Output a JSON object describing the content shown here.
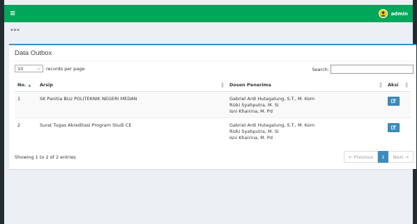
{
  "navbar": {
    "menu_icon": "hamburger-icon",
    "user_name": "admin",
    "user_icon": "avatar-icon",
    "color": "#00a65a"
  },
  "breadcrumb": "***",
  "box": {
    "title": "Data Outbox",
    "length_value": "10",
    "length_label": "records per page",
    "search_label": "Search:",
    "search_value": "",
    "accent": "#3c8dbc"
  },
  "table": {
    "headers": {
      "no": "No.",
      "arsip": "Arsip",
      "dosen": "Dosen Penerima",
      "aksi": "Aksi"
    },
    "rows": [
      {
        "no": "1",
        "arsip": "SK Panitia BLU POLITEKNIK NEGERI MEDAN",
        "dosen": [
          "Gabriel Ardi Hutagalung, S.T., M. Kom",
          "Rizki Syahputra, M. Si",
          "Isni Khairina, M. Pd"
        ],
        "action_icon": "edit-icon"
      },
      {
        "no": "2",
        "arsip": "Surat Tugas Akreditasi Program Studi CE",
        "dosen": [
          "Gabriel Ardi Hutagalung, S.T., M. Kom",
          "Rizki Syahputra, M. Si",
          "Isni Khairina, M. Pd"
        ],
        "action_icon": "edit-icon"
      }
    ]
  },
  "footer": {
    "info": "Showing 1 to 2 of 2 entries",
    "previous": "← Previous",
    "current_page": "1",
    "next": "Next →"
  }
}
